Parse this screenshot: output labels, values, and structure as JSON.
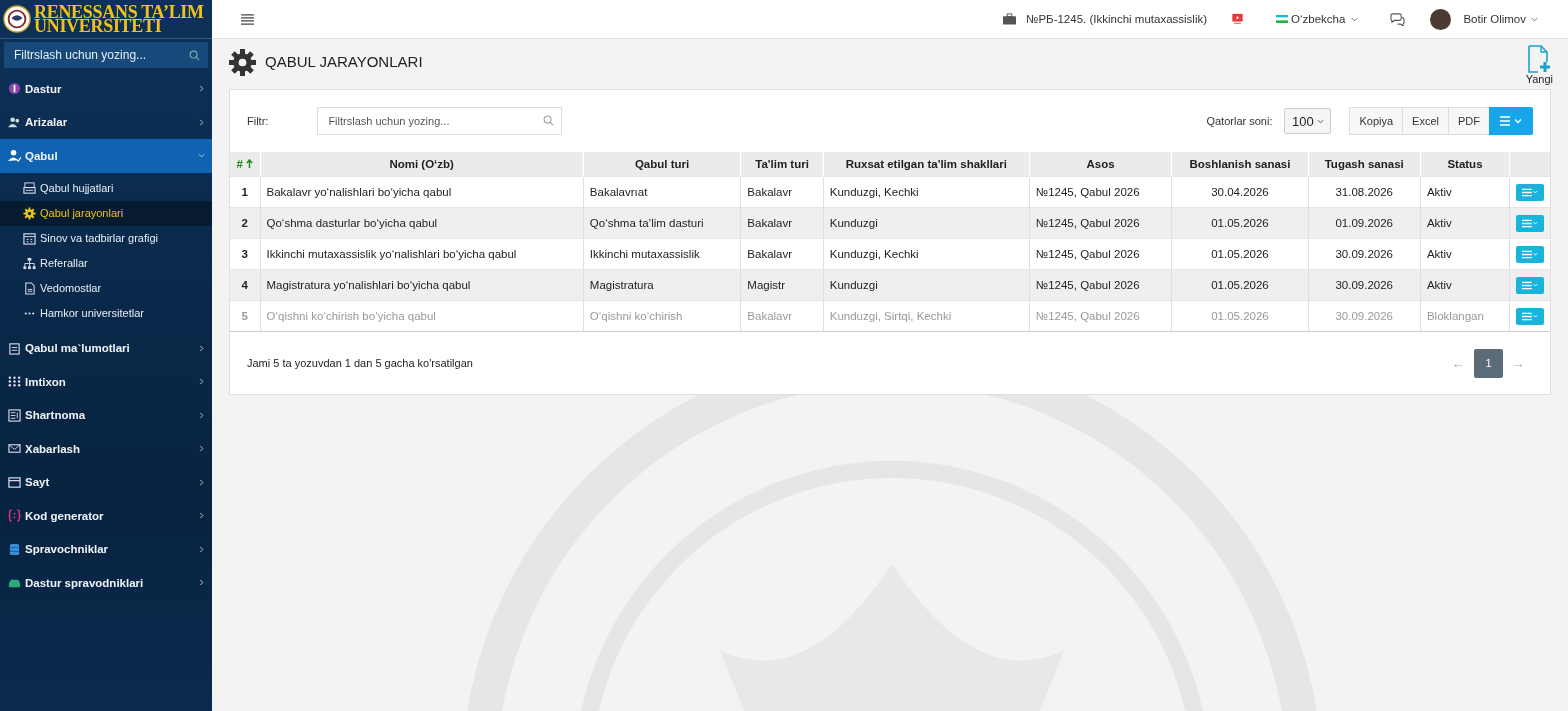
{
  "brand": {
    "line1": "RENESSANS TA’LIM",
    "line2": "UNIVERSITETI"
  },
  "sidebar": {
    "search_placeholder": "Filtrslash uchun yozing...",
    "items": [
      {
        "label": "Dastur",
        "expanded": false,
        "selected": false
      },
      {
        "label": "Arizalar",
        "expanded": false,
        "selected": false
      },
      {
        "label": "Qabul",
        "expanded": true,
        "selected": true,
        "children": [
          {
            "label": "Qabul hujjatlari",
            "selected": false
          },
          {
            "label": "Qabul jarayonlari",
            "selected": true
          },
          {
            "label": "Sinov va tadbirlar grafigi",
            "selected": false
          },
          {
            "label": "Referallar",
            "selected": false
          },
          {
            "label": "Vedomostlar",
            "selected": false
          },
          {
            "label": "Hamkor universitetlar",
            "selected": false
          }
        ]
      },
      {
        "label": "Qabul ma`lumotlari",
        "expanded": false,
        "selected": false
      },
      {
        "label": "Imtixon",
        "expanded": false,
        "selected": false
      },
      {
        "label": "Shartnoma",
        "expanded": false,
        "selected": false
      },
      {
        "label": "Xabarlash",
        "expanded": false,
        "selected": false
      },
      {
        "label": "Sayt",
        "expanded": false,
        "selected": false
      },
      {
        "label": "Kod generator",
        "expanded": false,
        "selected": false
      },
      {
        "label": "Spravochniklar",
        "expanded": false,
        "selected": false
      },
      {
        "label": "Dastur spravodniklari",
        "expanded": false,
        "selected": false
      }
    ]
  },
  "topbar": {
    "org": "№РБ-1245. (Ikkinchi mutaxassislik)",
    "language": "O‘zbekcha",
    "user": "Botir Olimov"
  },
  "page": {
    "title": "QABUL JARAYONLARI",
    "new_button": "Yangi"
  },
  "filter": {
    "label": "Filtr:",
    "placeholder": "Filtrslash uchun yozing..."
  },
  "rows_per_page": {
    "label": "Qatorlar soni:",
    "value": "100"
  },
  "export_buttons": [
    "Kopiya",
    "Excel",
    "PDF"
  ],
  "table": {
    "columns": [
      {
        "label": "#",
        "sorted": true
      },
      {
        "label": "Nomi (O‘zb)",
        "sorted": false
      },
      {
        "label": "Qabul turi",
        "sorted": false
      },
      {
        "label": "Ta'lim turi",
        "sorted": false
      },
      {
        "label": "Ruxsat etilgan ta'lim shakllari",
        "sorted": false
      },
      {
        "label": "Asos",
        "sorted": false
      },
      {
        "label": "Boshlanish sanasi",
        "sorted": false
      },
      {
        "label": "Tugash sanasi",
        "sorted": false
      },
      {
        "label": "Status",
        "sorted": false
      }
    ],
    "rows": [
      {
        "disabled": false,
        "cells": [
          "1",
          "Bakalavr yo‘nalishlari bo‘yicha qabul",
          "Bakalavrıat",
          "Bakalavr",
          "Kunduzgi, Kechki",
          "№1245, Qabul 2026",
          "30.04.2026",
          "31.08.2026",
          "Aktiv"
        ]
      },
      {
        "disabled": false,
        "cells": [
          "2",
          "Qo‘shma dasturlar bo‘yicha qabul",
          "Qo‘shma ta’lim dasturi",
          "Bakalavr",
          "Kunduzgi",
          "№1245, Qabul 2026",
          "01.05.2026",
          "01.09.2026",
          "Aktiv"
        ]
      },
      {
        "disabled": false,
        "cells": [
          "3",
          "Ikkinchi mutaxassislik yo‘nalishlari bo‘yicha qabul",
          "Ikkinchi mutaxassislik",
          "Bakalavr",
          "Kunduzgi, Kechki",
          "№1245, Qabul 2026",
          "01.05.2026",
          "30.09.2026",
          "Aktiv"
        ]
      },
      {
        "disabled": false,
        "cells": [
          "4",
          "Magistratura yo‘nalishlari bo‘yicha qabul",
          "Magistratura",
          "Magistr",
          "Kunduzgi",
          "№1245, Qabul 2026",
          "01.05.2026",
          "30.09.2026",
          "Aktiv"
        ]
      },
      {
        "disabled": true,
        "cells": [
          "5",
          "O‘qishni ko‘chirish bo‘yicha qabul",
          "O‘qishni ko‘chirish",
          "Bakalavr",
          "Kunduzgi, Sirtqi, Kechki",
          "№1245, Qabul 2026",
          "01.05.2026",
          "30.09.2026",
          "Bloklangan"
        ]
      }
    ]
  },
  "footer": {
    "summary": "Jami 5 ta yozuvdan 1 dan 5 gacha ko'rsatilgan",
    "prev": "←",
    "next": "→",
    "pages": [
      {
        "label": "1",
        "selected": true
      }
    ]
  }
}
